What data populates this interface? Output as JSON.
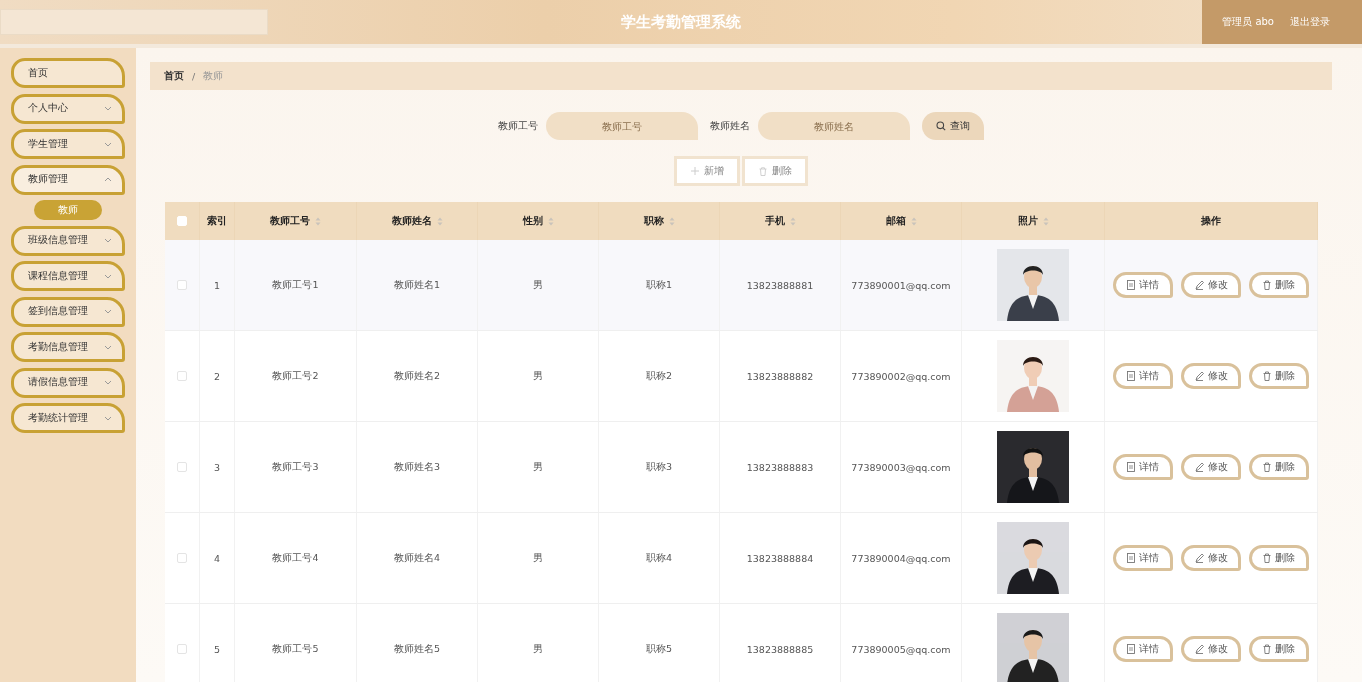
{
  "header": {
    "title": "学生考勤管理系统",
    "user": "管理员 abo",
    "logout": "退出登录"
  },
  "sidebar": {
    "items": [
      {
        "label": "首页",
        "expandable": false,
        "expanded": false
      },
      {
        "label": "个人中心",
        "expandable": true,
        "expanded": false
      },
      {
        "label": "学生管理",
        "expandable": true,
        "expanded": false
      },
      {
        "label": "教师管理",
        "expandable": true,
        "expanded": true,
        "children": [
          {
            "label": "教师",
            "selected": true
          }
        ]
      },
      {
        "label": "班级信息管理",
        "expandable": true,
        "expanded": false
      },
      {
        "label": "课程信息管理",
        "expandable": true,
        "expanded": false
      },
      {
        "label": "签到信息管理",
        "expandable": true,
        "expanded": false
      },
      {
        "label": "考勤信息管理",
        "expandable": true,
        "expanded": false
      },
      {
        "label": "请假信息管理",
        "expandable": true,
        "expanded": false
      },
      {
        "label": "考勤统计管理",
        "expandable": true,
        "expanded": false
      }
    ]
  },
  "breadcrumb": {
    "items": [
      "首页",
      "教师"
    ],
    "separator": "/"
  },
  "search": {
    "fields": [
      {
        "label": "教师工号",
        "placeholder": "教师工号"
      },
      {
        "label": "教师姓名",
        "placeholder": "教师姓名"
      }
    ],
    "button": "查询"
  },
  "toolbar": {
    "add": "新增",
    "delete": "删除"
  },
  "table": {
    "columns": [
      {
        "label": "索引",
        "sortable": false
      },
      {
        "label": "教师工号",
        "sortable": true
      },
      {
        "label": "教师姓名",
        "sortable": true
      },
      {
        "label": "性别",
        "sortable": true
      },
      {
        "label": "职称",
        "sortable": true
      },
      {
        "label": "手机",
        "sortable": true
      },
      {
        "label": "邮箱",
        "sortable": true
      },
      {
        "label": "照片",
        "sortable": true
      },
      {
        "label": "操作",
        "sortable": false
      }
    ],
    "all_checked": false,
    "rows": [
      {
        "checked": false,
        "cells": [
          "1",
          "教师工号1",
          "教师姓名1",
          "男",
          "职称1",
          "13823888881",
          "773890001@qq.com"
        ],
        "actions": [
          "详情",
          "修改",
          "删除"
        ]
      },
      {
        "checked": false,
        "cells": [
          "2",
          "教师工号2",
          "教师姓名2",
          "男",
          "职称2",
          "13823888882",
          "773890002@qq.com"
        ],
        "actions": [
          "详情",
          "修改",
          "删除"
        ]
      },
      {
        "checked": false,
        "cells": [
          "3",
          "教师工号3",
          "教师姓名3",
          "男",
          "职称3",
          "13823888883",
          "773890003@qq.com"
        ],
        "actions": [
          "详情",
          "修改",
          "删除"
        ]
      },
      {
        "checked": false,
        "cells": [
          "4",
          "教师工号4",
          "教师姓名4",
          "男",
          "职称4",
          "13823888884",
          "773890004@qq.com"
        ],
        "actions": [
          "详情",
          "修改",
          "删除"
        ]
      },
      {
        "checked": false,
        "cells": [
          "5",
          "教师工号5",
          "教师姓名5",
          "男",
          "职称5",
          "13823888885",
          "773890005@qq.com"
        ],
        "actions": [
          "详情",
          "修改",
          "删除"
        ]
      }
    ]
  }
}
